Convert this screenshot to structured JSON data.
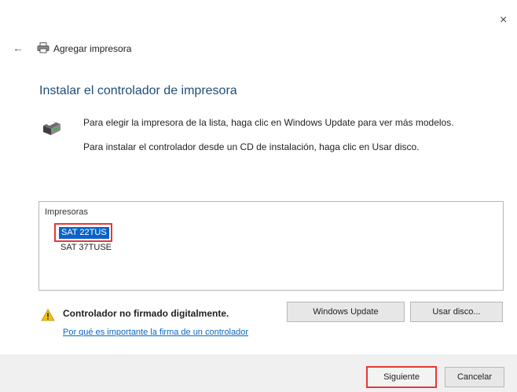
{
  "window": {
    "title": "Agregar impresora",
    "back_icon": "←",
    "close_icon": "×"
  },
  "main": {
    "heading": "Instalar el controlador de impresora",
    "description_1": "Para elegir la impresora de la lista, haga clic en Windows Update para ver más modelos.",
    "description_2": "Para instalar el controlador desde un CD de instalación, haga clic en Usar disco."
  },
  "printers": {
    "header": "Impresoras",
    "items": [
      "SAT 22TUS",
      "SAT 37TUSE"
    ],
    "selected": "SAT 22TUS"
  },
  "warning": {
    "text": "Controlador no firmado digitalmente.",
    "link": "Por qué es importante la firma de un controlador"
  },
  "buttons": {
    "windows_update": "Windows Update",
    "use_disk": "Usar disco...",
    "next": "Siguiente",
    "cancel": "Cancelar"
  },
  "colors": {
    "selection": "#0a64c8",
    "highlight": "#e53935",
    "heading": "#1f4e79",
    "link": "#0a66c2"
  }
}
